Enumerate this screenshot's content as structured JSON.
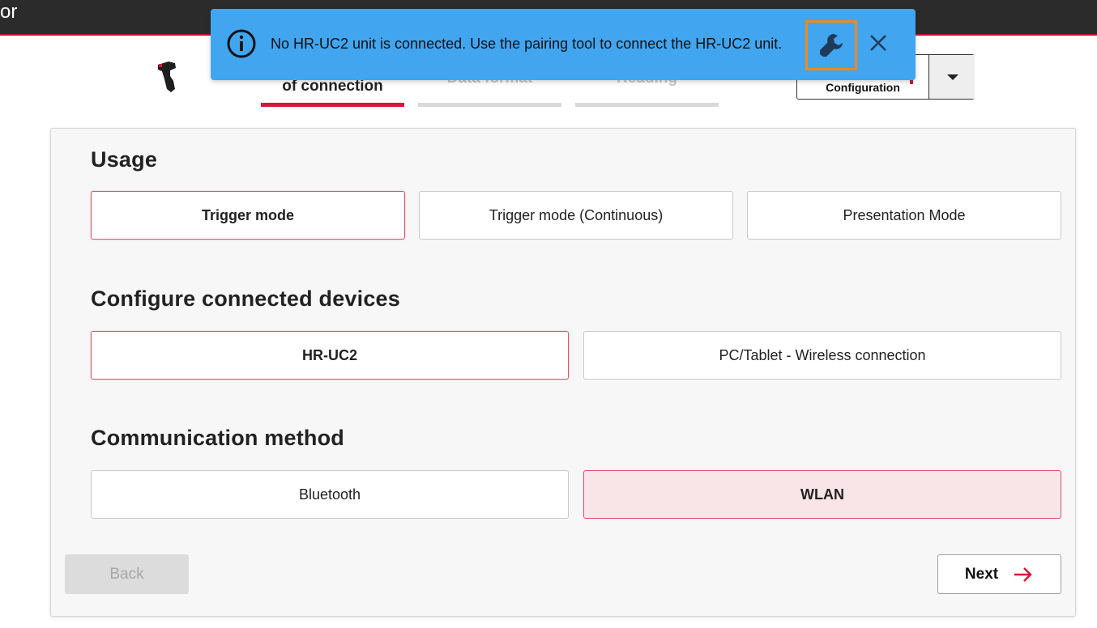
{
  "app": {
    "title_fragment": "or"
  },
  "steps": [
    {
      "label": "of connection",
      "active": true
    },
    {
      "label": "Data format",
      "active": false
    },
    {
      "label": "Reading",
      "active": false
    }
  ],
  "config": {
    "label": "Configuration"
  },
  "toast": {
    "message": "No HR-UC2 unit is connected. Use the pairing tool to connect the HR-UC2 unit.",
    "icons": {
      "info": "info-icon",
      "tool": "wrench-icon",
      "close": "close-icon"
    }
  },
  "sections": {
    "usage": {
      "title": "Usage",
      "options": [
        "Trigger mode",
        "Trigger mode (Continuous)",
        "Presentation Mode"
      ],
      "selected": "Trigger mode"
    },
    "devices": {
      "title": "Configure connected devices",
      "options": [
        "HR-UC2",
        "PC/Tablet - Wireless connection"
      ],
      "selected": "HR-UC2"
    },
    "communication": {
      "title": "Communication method",
      "options": [
        "Bluetooth",
        "WLAN"
      ],
      "selected": "WLAN"
    }
  },
  "footer": {
    "back_label": "Back",
    "next_label": "Next"
  },
  "colors": {
    "accent": "#d5153a",
    "toast_bg": "#42a5f0",
    "highlight": "#f08a1a",
    "topbar": "#2b2b2b"
  }
}
